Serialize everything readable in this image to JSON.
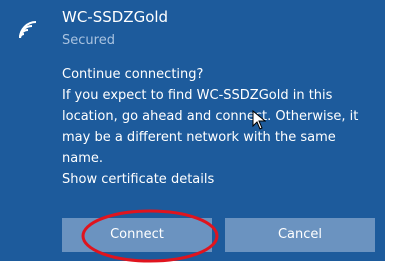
{
  "network": {
    "name": "WC-SSDZGold",
    "status": "Secured",
    "icon": "wifi-icon"
  },
  "message": {
    "lines": [
      "Continue connecting?",
      "If you expect to find WC-SSDZGold in this",
      "location, go ahead and connect. Otherwise, it",
      "may be a different network with the same",
      "name."
    ],
    "certificate_link": "Show certificate details"
  },
  "buttons": {
    "connect_label": "Connect",
    "cancel_label": "Cancel"
  },
  "colors": {
    "panel_background": "#1d5b9c",
    "button_background": "#6b93c0",
    "highlight_ellipse": "#e0141e"
  }
}
